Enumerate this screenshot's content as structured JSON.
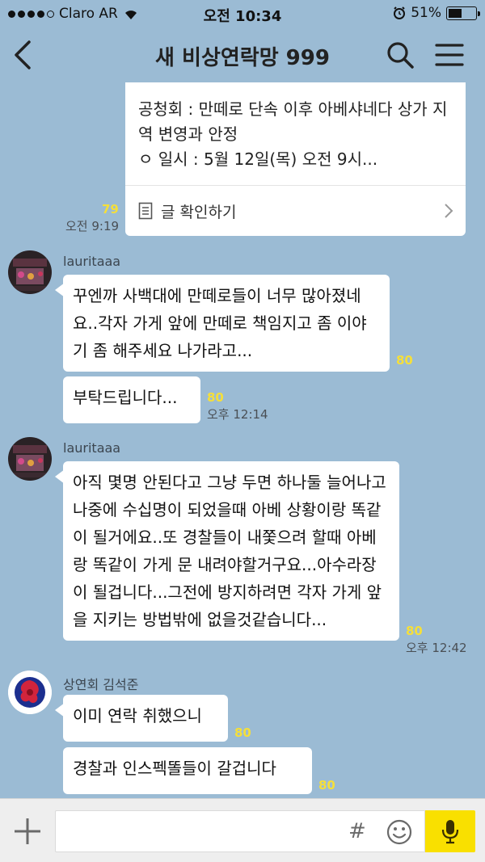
{
  "status_bar": {
    "carrier": "Claro AR",
    "time": "오전 10:34",
    "battery_percent": "51%",
    "battery_level": 0.51
  },
  "header": {
    "title": "새 비상연락망 999"
  },
  "notice": {
    "text": "공청회 : 만떼로 단속 이후 아베샤네다 상가 지역 변영과 안정\nㅇ 일시 : 5월 12일(목) 오전 9시...",
    "footer_label": "글 확인하기",
    "unread": "79",
    "time": "오전 9:19"
  },
  "messages": [
    {
      "sender": "lauritaaa",
      "bubbles": [
        {
          "text": "꾸엔까 사백대에 만떼로들이 너무 많아졌네요..각자 가게 앞에 만떼로 책임지고 좀 이야기 좀 해주세요 나가라고...",
          "unread": "80",
          "time": ""
        },
        {
          "text": "부탁드립니다...",
          "unread": "80",
          "time": "오후 12:14"
        }
      ]
    },
    {
      "sender": "lauritaaa",
      "bubbles": [
        {
          "text": "아직 몇명 안된다고 그냥 두면 하나둘 늘어나고 나중에 수십명이 되었을때 아베 상황이랑 똑같이 될거에요..또 경찰들이 내쫓으려 할때 아베랑 똑같이 가게 문 내려야할거구요...아수라장이 될겁니다...그전에 방지하려면 각자 가게 앞을 지키는 방법밖에 없을것같습니다...",
          "unread": "80",
          "time": "오후 12:42"
        }
      ]
    },
    {
      "sender": "상연회 김석준",
      "bubbles": [
        {
          "text": "이미 연락 취했으니",
          "unread": "80",
          "time": ""
        },
        {
          "text": "경찰과 인스펙똘들이 갈겁니다",
          "unread": "80",
          "time": ""
        }
      ]
    }
  ],
  "input": {
    "placeholder": "",
    "hash_symbol": "#"
  },
  "colors": {
    "background": "#9bbbd4",
    "accent_yellow": "#f9e000",
    "unread_yellow": "#f5df3a"
  },
  "icons": [
    "back-icon",
    "search-icon",
    "menu-icon",
    "document-icon",
    "chevron-right-icon",
    "plus-icon",
    "hash-icon",
    "emoji-icon",
    "mic-icon",
    "wifi-icon",
    "alarm-icon",
    "battery-icon"
  ]
}
